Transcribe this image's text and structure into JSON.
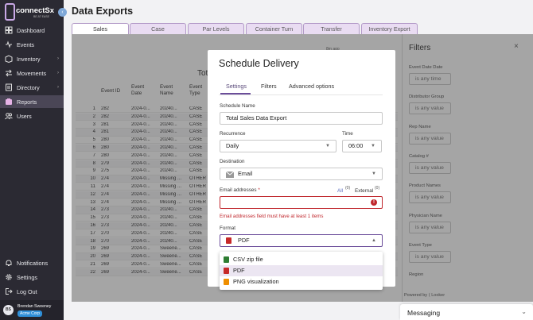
{
  "app": {
    "logo_text": "connectSx",
    "logo_sub": "BE AT EASE",
    "collapse_icon": "‹"
  },
  "sidebar": {
    "items": [
      {
        "label": "Dashboard",
        "icon": "dashboard-icon",
        "chevron": ""
      },
      {
        "label": "Events",
        "icon": "events-icon",
        "chevron": ""
      },
      {
        "label": "Inventory",
        "icon": "inventory-icon",
        "chevron": "›"
      },
      {
        "label": "Movements",
        "icon": "movements-icon",
        "chevron": "›"
      },
      {
        "label": "Directory",
        "icon": "directory-icon",
        "chevron": "›"
      },
      {
        "label": "Reports",
        "icon": "reports-icon",
        "chevron": "",
        "active": true
      },
      {
        "label": "Users",
        "icon": "users-icon",
        "chevron": ""
      }
    ],
    "bottom_items": [
      {
        "label": "Notifications",
        "icon": "bell-icon"
      },
      {
        "label": "Settings",
        "icon": "gear-icon"
      },
      {
        "label": "Log Out",
        "icon": "logout-icon"
      }
    ],
    "user": {
      "initials": "BS",
      "name": "Brendan Sweeney",
      "org": "Acme Corp"
    }
  },
  "page": {
    "title": "Data Exports",
    "tabs": [
      "Sales",
      "Case",
      "Par Levels",
      "Container Turn",
      "Transfer",
      "Inventory Export"
    ],
    "active_tab": "Sales"
  },
  "table": {
    "title_partial": "Tot",
    "updated": "8m ago",
    "headers": [
      "Event ID",
      "Event Date",
      "Event Name",
      "Event Type"
    ],
    "rows": [
      [
        "1",
        "282",
        "2024-0...",
        "20240...",
        "CASE"
      ],
      [
        "2",
        "282",
        "2024-0...",
        "20240...",
        "CASE"
      ],
      [
        "3",
        "281",
        "2024-0...",
        "20240...",
        "CASE"
      ],
      [
        "4",
        "281",
        "2024-0...",
        "20240...",
        "CASE"
      ],
      [
        "5",
        "280",
        "2024-0...",
        "20240...",
        "CASE"
      ],
      [
        "6",
        "280",
        "2024-0...",
        "20240...",
        "CASE"
      ],
      [
        "7",
        "280",
        "2024-0...",
        "20240...",
        "CASE"
      ],
      [
        "8",
        "279",
        "2024-0...",
        "20240...",
        "CASE"
      ],
      [
        "9",
        "275",
        "2024-0...",
        "20240...",
        "CASE"
      ],
      [
        "10",
        "274",
        "2024-0...",
        "Missing ...",
        "OTHER"
      ],
      [
        "11",
        "274",
        "2024-0...",
        "Missing ...",
        "OTHER"
      ],
      [
        "12",
        "274",
        "2024-0...",
        "Missing ...",
        "OTHER"
      ],
      [
        "13",
        "274",
        "2024-0...",
        "Missing ...",
        "OTHER"
      ],
      [
        "14",
        "273",
        "2024-0...",
        "20240...",
        "CASE"
      ],
      [
        "15",
        "273",
        "2024-0...",
        "20240...",
        "CASE"
      ],
      [
        "16",
        "273",
        "2024-0...",
        "20240...",
        "CASE"
      ],
      [
        "17",
        "270",
        "2024-0...",
        "20240...",
        "CASE"
      ],
      [
        "18",
        "270",
        "2024-0...",
        "20240...",
        "CASE"
      ],
      [
        "19",
        "269",
        "2024-0...",
        "Sweene...",
        "CASE"
      ],
      [
        "20",
        "269",
        "2024-0...",
        "Sweene...",
        "CASE"
      ],
      [
        "21",
        "269",
        "2024-0...",
        "Sweene...",
        "CASE"
      ],
      [
        "22",
        "269",
        "2024-0...",
        "Sweene...",
        "CASE"
      ]
    ]
  },
  "filters": {
    "title": "Filters",
    "close_icon": "×",
    "fields": [
      {
        "label": "Event Date Date",
        "value": "is any time"
      },
      {
        "label": "Distributor Group",
        "value": "is any value"
      },
      {
        "label": "Rep Name",
        "value": "is any value"
      },
      {
        "label": "Catalog #",
        "value": "is any value"
      },
      {
        "label": "Product Names",
        "value": "is any value"
      },
      {
        "label": "Physician Name",
        "value": "is any value"
      },
      {
        "label": "Event Type",
        "value": "is any value"
      },
      {
        "label": "Region",
        "value": ""
      }
    ],
    "powered_by": "Powered by ⟨ Looker"
  },
  "modal": {
    "title": "Schedule Delivery",
    "tabs": [
      "Settings",
      "Filters",
      "Advanced options"
    ],
    "active_tab": "Settings",
    "schedule_name_label": "Schedule Name",
    "schedule_name_value": "Total Sales Data Export",
    "recurrence_label": "Recurrence",
    "recurrence_value": "Daily",
    "time_label": "Time",
    "time_value": "06:00",
    "destination_label": "Destination",
    "destination_value": "Email",
    "email_label": "Email addresses",
    "email_required": "*",
    "email_all": "All",
    "email_all_count": "(0)",
    "email_external": "External",
    "email_external_count": "(0)",
    "email_value": "",
    "email_error": "Email addresses field must have at least 1 items",
    "format_label": "Format",
    "format_value": "PDF",
    "format_options": [
      {
        "label": "CSV zip file",
        "color": "#2e7d32",
        "selected": false
      },
      {
        "label": "PDF",
        "color": "#c62828",
        "selected": true
      },
      {
        "label": "PNG visualization",
        "color": "#ef8f00",
        "selected": false
      }
    ]
  },
  "messaging": {
    "title": "Messaging",
    "chevron": "⌄"
  }
}
